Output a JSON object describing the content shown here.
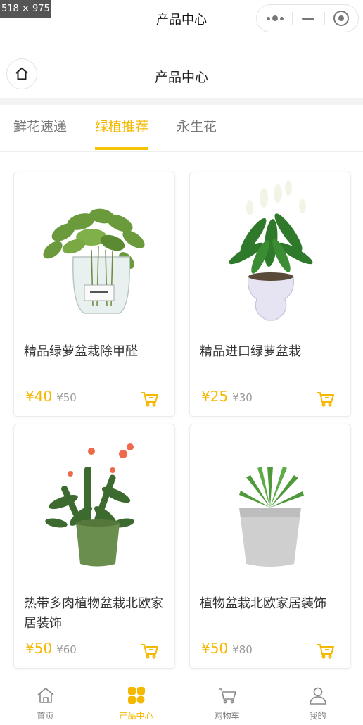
{
  "screen_size_label": "518 × 975",
  "navbar": {
    "title": "产品中心"
  },
  "header": {
    "title": "产品中心"
  },
  "tabs": [
    {
      "label": "鲜花速递",
      "active": false
    },
    {
      "label": "绿植推荐",
      "active": true
    },
    {
      "label": "永生花",
      "active": false
    }
  ],
  "products": [
    {
      "name": "精品绿萝盆栽除甲醛",
      "price": "¥40",
      "old_price": "¥50",
      "image": "pothos-glass-vase"
    },
    {
      "name": "精品进口绿萝盆栽",
      "price": "¥25",
      "old_price": "¥30",
      "image": "peace-lily-pot"
    },
    {
      "name": "热带多肉植物盆栽北欧家居装饰",
      "price": "¥50",
      "old_price": "¥60",
      "image": "flowering-succulent-green-pot"
    },
    {
      "name": "植物盆栽北欧家居装饰",
      "price": "¥50",
      "old_price": "¥80",
      "image": "aloe-gray-pot"
    }
  ],
  "tabbar": [
    {
      "label": "首页",
      "icon": "home-icon",
      "active": false
    },
    {
      "label": "产品中心",
      "icon": "grid-icon",
      "active": true
    },
    {
      "label": "购物车",
      "icon": "cart-icon",
      "active": false
    },
    {
      "label": "我的",
      "icon": "user-icon",
      "active": false
    }
  ],
  "colors": {
    "accent": "#f5b800",
    "text": "#333333",
    "muted": "#999999"
  }
}
